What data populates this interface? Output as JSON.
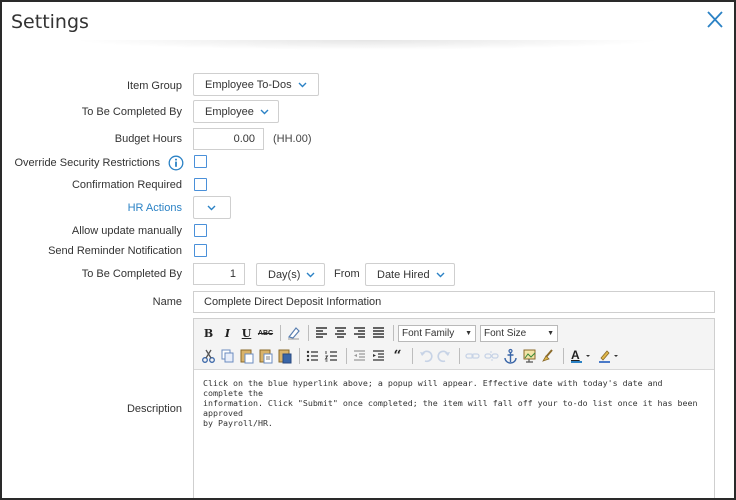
{
  "dialog": {
    "title": "Settings",
    "close_label": "X"
  },
  "fields": {
    "item_group": {
      "label": "Item Group",
      "value": "Employee To-Dos"
    },
    "completed_by_who": {
      "label": "To Be Completed By",
      "value": "Employee"
    },
    "budget_hours": {
      "label": "Budget Hours",
      "value": "0.00",
      "note": "(HH.00)"
    },
    "override_security": {
      "label": "Override Security Restrictions",
      "checked": false
    },
    "confirmation_required": {
      "label": "Confirmation Required",
      "checked": false
    },
    "hr_actions": {
      "label": "HR Actions",
      "value": ""
    },
    "allow_update": {
      "label": "Allow update manually",
      "checked": false
    },
    "send_reminder": {
      "label": "Send Reminder Notification",
      "checked": false
    },
    "completed_by_when": {
      "label": "To Be Completed By",
      "amount": "1",
      "unit": "Day(s)",
      "from_label": "From",
      "from_value": "Date Hired"
    },
    "name": {
      "label": "Name",
      "value": "Complete Direct Deposit Information"
    },
    "description": {
      "label": "Description",
      "text_lines": [
        "Click on the blue hyperlink above; a popup will appear. Effective date with today's date and complete the",
        "information. Click \"Submit\" once completed; the item will fall off your to-do list once it has been approved",
        "by Payroll/HR."
      ]
    }
  },
  "toolbar": {
    "bold": "B",
    "italic": "I",
    "underline": "U",
    "strike": "ABC",
    "font_family": "Font Family",
    "font_size": "Font Size"
  },
  "colors": {
    "accent": "#2b82c5",
    "border": "#cfcfcf",
    "toolbar_bg": "#f4f4f4"
  }
}
